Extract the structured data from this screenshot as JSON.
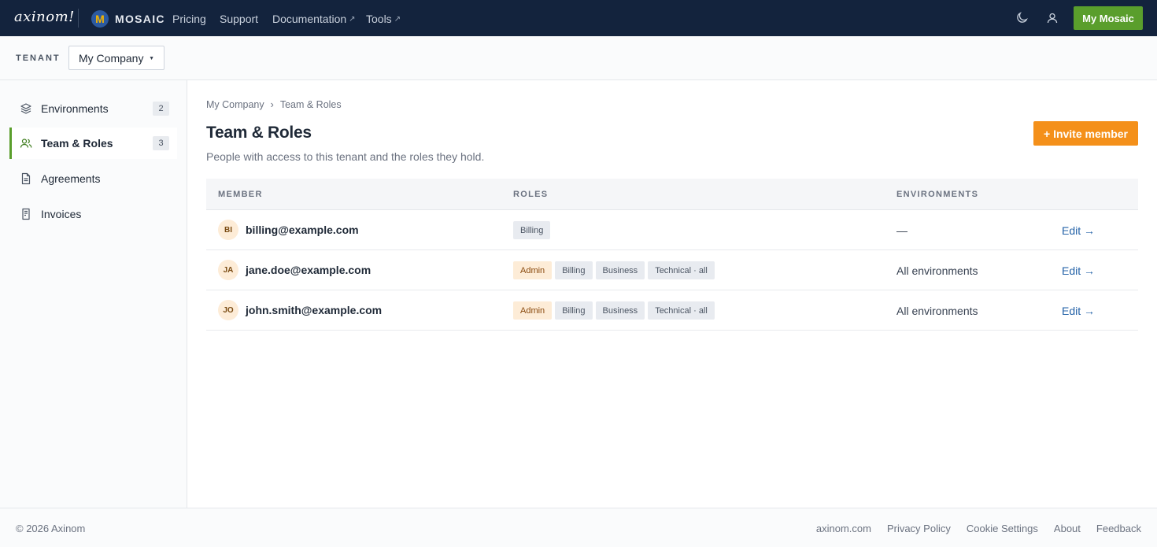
{
  "topbar": {
    "brand": "axinom!",
    "product": "MOSAIC",
    "nav": [
      {
        "label": "Pricing",
        "external": false
      },
      {
        "label": "Support",
        "external": false
      },
      {
        "label": "Documentation",
        "external": true
      },
      {
        "label": "Tools",
        "external": true
      }
    ],
    "cta_label": "My Mosaic",
    "icons": [
      "moon-icon",
      "user-icon"
    ]
  },
  "tenant": {
    "label": "TENANT",
    "selected": "My Company"
  },
  "sidebar": {
    "items": [
      {
        "label": "Environments",
        "count": "2",
        "icon": "layers-icon",
        "active": false
      },
      {
        "label": "Team & Roles",
        "count": "3",
        "icon": "users-icon",
        "active": true
      },
      {
        "label": "Agreements",
        "count": null,
        "icon": "document-icon",
        "active": false
      },
      {
        "label": "Invoices",
        "count": null,
        "icon": "receipt-icon",
        "active": false
      }
    ]
  },
  "main": {
    "breadcrumb": [
      "My Company",
      "Team & Roles"
    ],
    "breadcrumb_sep": "›",
    "title": "Team & Roles",
    "subtitle": "People with access to this tenant and the roles they hold.",
    "invite_label": "+ Invite member",
    "table": {
      "headers": [
        "MEMBER",
        "ROLES",
        "ENVIRONMENTS"
      ],
      "rows": [
        {
          "initials": "BI",
          "email": "billing@example.com",
          "roles": [
            "Billing"
          ],
          "environments": "—",
          "edit": "Edit →"
        },
        {
          "initials": "JA",
          "email": "jane.doe@example.com",
          "roles": [
            "Admin",
            "Billing",
            "Business",
            "Technical · all"
          ],
          "environments": "All environments",
          "edit": "Edit →"
        },
        {
          "initials": "JO",
          "email": "john.smith@example.com",
          "roles": [
            "Admin",
            "Billing",
            "Business",
            "Technical · all"
          ],
          "environments": "All environments",
          "edit": "Edit →"
        }
      ]
    }
  },
  "footer": {
    "copyright": "© 2026 Axinom",
    "links": [
      "axinom.com",
      "Privacy Policy",
      "Cookie Settings",
      "About",
      "Feedback"
    ]
  },
  "colors": {
    "topbar": "#13233d",
    "cta_green": "#5a9e2c",
    "invite_orange": "#f4901a",
    "link_blue": "#2563a8",
    "admin_tag": "#fdecd7"
  }
}
